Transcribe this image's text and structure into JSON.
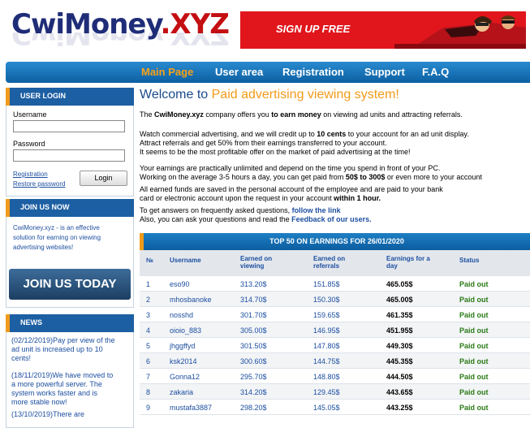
{
  "logo": {
    "name": "CwiMoney",
    "tld": ".XYZ"
  },
  "banner": {
    "text": "SIGN UP FREE"
  },
  "nav": [
    "Main Page",
    "User area",
    "Registration",
    "Support",
    "F.A.Q"
  ],
  "login": {
    "title": "USER LOGIN",
    "username_label": "Username",
    "password_label": "Password",
    "registration": "Registration",
    "restore": "Restore password",
    "button": "Login"
  },
  "join": {
    "title": "JOIN US NOW",
    "text": [
      "CwiMoney.xyz - is an effective",
      "solution for earning on viewing",
      "advertising websites!"
    ],
    "button": "JOIN US TODAY"
  },
  "news": {
    "title": "NEWS",
    "items": [
      [
        "(02/12/2019)Pay per view of the",
        "ad unit is increased up to 10",
        "cents!"
      ],
      [
        "(18/11/2019)We have moved to",
        "a more powerful server. The",
        "system works faster and is",
        "more stable now!"
      ],
      [
        "(13/10/2019)There are"
      ]
    ]
  },
  "main": {
    "title_plain": "Welcome to ",
    "title_hl": "Paid advertising viewing system!",
    "intro": {
      "a": "The ",
      "b": "CwiMoney.xyz",
      "c": " company offers you ",
      "d": "to earn money",
      "e": " on viewing ad units and attracting referrals."
    },
    "p2": {
      "a": "Watch commercial advertising, and we will credit up to ",
      "b": "10 cents",
      "c": " to your account for an ad unit display."
    },
    "p3": "Attract referrals and get 50% from their earnings transferred to your account.",
    "p4": "It seems to be the most profitable offer on the market of paid advertising at the time!",
    "p5": "Your earnings are practically unlimited and depend on the time you spend in front of your PC.",
    "p6": {
      "a": "Working on the average 3-5 hours a day, you can get paid from ",
      "b": "50$ to 300$",
      "c": " or even more to your account"
    },
    "p7": "All earned funds are saved in the personal account of the employee and are paid to your bank",
    "p8": {
      "a": "card or electronic account upon the request in your account ",
      "b": "within 1 hour."
    },
    "p9": {
      "a": "To get answers on frequently asked questions, ",
      "b": "follow the link"
    },
    "p10": {
      "a": "Also, you can ask your questions and read the ",
      "b": "Feedback of our users."
    }
  },
  "table": {
    "title": "TOP 50 ON EARNINGS FOR 26/01/2020",
    "headers": {
      "no": "№",
      "user": "Username",
      "view": [
        "Earned on",
        "viewing"
      ],
      "ref": [
        "Earned on",
        "referrals"
      ],
      "day": [
        "Earnings for a",
        "day"
      ],
      "status": "Status"
    },
    "rows": [
      [
        "1",
        "eso90",
        "313.20$",
        "151.85$",
        "465.05$",
        "Paid out"
      ],
      [
        "2",
        "mhosbanoke",
        "314.70$",
        "150.30$",
        "465.00$",
        "Paid out"
      ],
      [
        "3",
        "nosshd",
        "301.70$",
        "159.65$",
        "461.35$",
        "Paid out"
      ],
      [
        "4",
        "oioio_883",
        "305.00$",
        "146.95$",
        "451.95$",
        "Paid out"
      ],
      [
        "5",
        "jhggffyd",
        "301.50$",
        "147.80$",
        "449.30$",
        "Paid out"
      ],
      [
        "6",
        "ksk2014",
        "300.60$",
        "144.75$",
        "445.35$",
        "Paid out"
      ],
      [
        "7",
        "Gonna12",
        "295.70$",
        "148.80$",
        "444.50$",
        "Paid out"
      ],
      [
        "8",
        "zakaria",
        "314.20$",
        "129.45$",
        "443.65$",
        "Paid out"
      ],
      [
        "9",
        "mustafa3887",
        "298.20$",
        "145.05$",
        "443.25$",
        "Paid out"
      ]
    ]
  }
}
